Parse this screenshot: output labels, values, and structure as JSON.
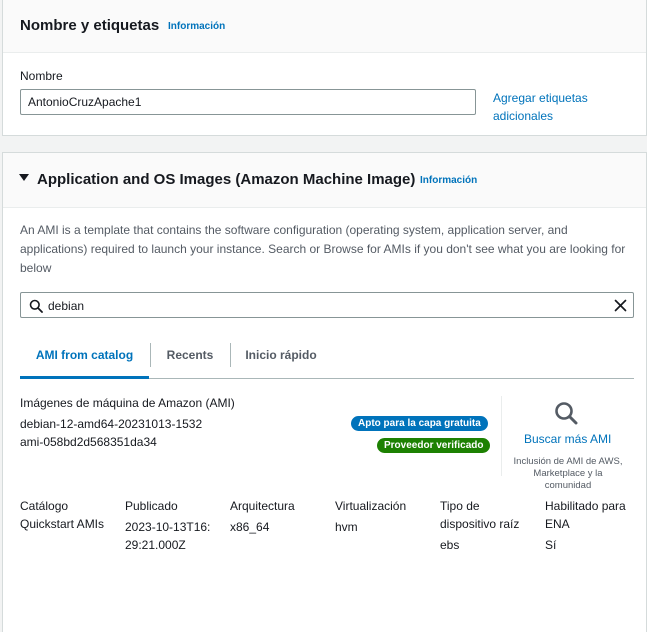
{
  "name_tags": {
    "title": "Nombre y etiquetas",
    "info": "Información",
    "name_label": "Nombre",
    "name_value": "AntonioCruzApache1",
    "add_tags_link": "Agregar etiquetas adicionales"
  },
  "ami_section": {
    "title": "Application and OS Images (Amazon Machine Image)",
    "info": "Información",
    "description": "An AMI is a template that contains the software configuration (operating system, application server, and applications) required to launch your instance. Search or Browse for AMIs if you don't see what you are looking for below",
    "search_value": "debian",
    "tabs": [
      {
        "label": "AMI from catalog"
      },
      {
        "label": "Recents"
      },
      {
        "label": "Inicio rápido"
      }
    ],
    "ami_heading": "Imágenes de máquina de Amazon (AMI)",
    "ami_name": "debian-12-amd64-20231013-1532",
    "ami_id": "ami-058bd2d568351da34",
    "badges": {
      "free_tier": "Apto para la capa gratuita",
      "verified": "Proveedor verificado"
    },
    "browse_more": "Buscar más AMI",
    "browse_note": "Inclusión de AMI de AWS, Marketplace y la comunidad",
    "attributes": [
      {
        "key": "Catálogo",
        "value": "Quickstart AMIs"
      },
      {
        "key": "Publicado",
        "value": "2023-10-13T16:29:21.000Z"
      },
      {
        "key": "Arquitectura",
        "value": "x86_64"
      },
      {
        "key": "Virtualización",
        "value": "hvm"
      },
      {
        "key": "Tipo de dispositivo raíz",
        "value": "ebs"
      },
      {
        "key": "Habilitado para ENA",
        "value": "Sí"
      }
    ]
  },
  "colors": {
    "link": "#0073bb",
    "free_badge": "#0073bb",
    "verified_badge": "#1d8102"
  }
}
